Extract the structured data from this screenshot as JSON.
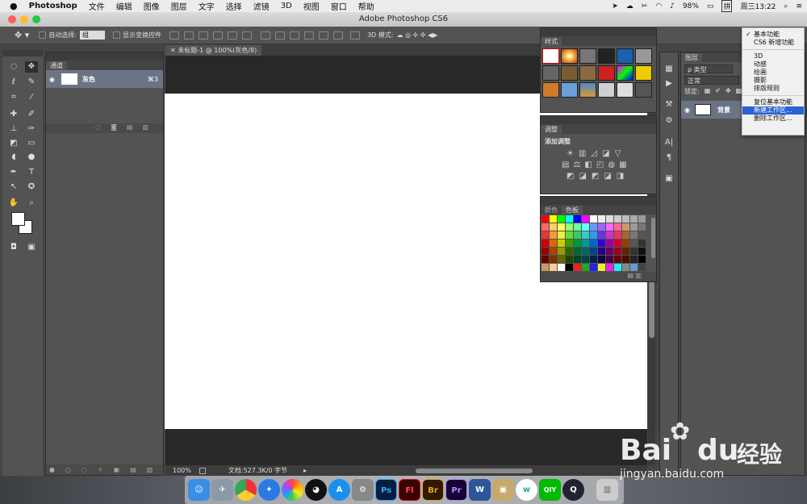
{
  "menubar": {
    "app": "Photoshop",
    "items": [
      "文件",
      "编辑",
      "图像",
      "图层",
      "文字",
      "选择",
      "滤镜",
      "3D",
      "视图",
      "窗口",
      "帮助"
    ],
    "battery": "98%",
    "input": "拼",
    "clock": "周三13:22"
  },
  "window": {
    "title": "Adobe Photoshop CS6"
  },
  "options": {
    "auto_select": "自动选择:",
    "auto_select_value": "组",
    "show_transform": "显示变换控件",
    "mode_3d": "3D 模式:"
  },
  "channels": {
    "tab": "通道",
    "row_label": "灰色",
    "row_shortcut": "⌘3"
  },
  "document": {
    "tab": "未标题-1 @ 100%(灰色/8)",
    "zoom": "100%",
    "info": "文档:527.3K/0 字节"
  },
  "styles": {
    "tab": "样式"
  },
  "adjustments": {
    "tab": "调整",
    "title": "添加调整"
  },
  "swatches": {
    "tab_color": "颜色",
    "tab_swatches": "色板"
  },
  "layers": {
    "tab": "图层",
    "kind": "ρ 类型",
    "blend": "正常",
    "lock": "锁定:",
    "layer_name": "背景"
  },
  "workspace_menu": {
    "items": [
      "基本功能",
      "CS6 新增功能",
      "3D",
      "动感",
      "绘画",
      "摄影",
      "排版规则",
      "复位基本功能",
      "新建工作区...",
      "删除工作区..."
    ],
    "checked_index": 0,
    "selected_index": 8
  },
  "watermark": {
    "brand": "Bai",
    "brand2": "du",
    "cn": "经验",
    "url": "jingyan.baidu.com"
  },
  "dock": {
    "labels": [
      "Ps",
      "Fl",
      "Br",
      "Pr",
      "W",
      "QIY"
    ]
  },
  "colors": {
    "accent": "#2a63d6",
    "panel": "#535353",
    "ps": "#31a8ff",
    "fl": "#cc1212",
    "br": "#e8a420",
    "pr": "#9999ff"
  }
}
